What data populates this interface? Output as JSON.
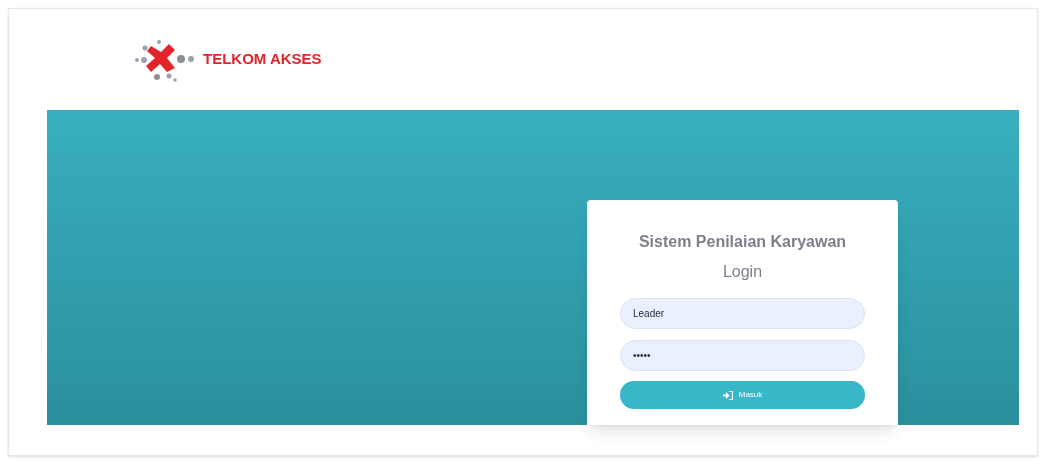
{
  "brand": {
    "name": "TELKOM AKSES"
  },
  "login": {
    "title": "Sistem Penilaian Karyawan",
    "subtitle": "Login",
    "username": {
      "value": "Leader"
    },
    "password": {
      "value": "•••••"
    },
    "submit": {
      "label": "Masuk"
    }
  }
}
